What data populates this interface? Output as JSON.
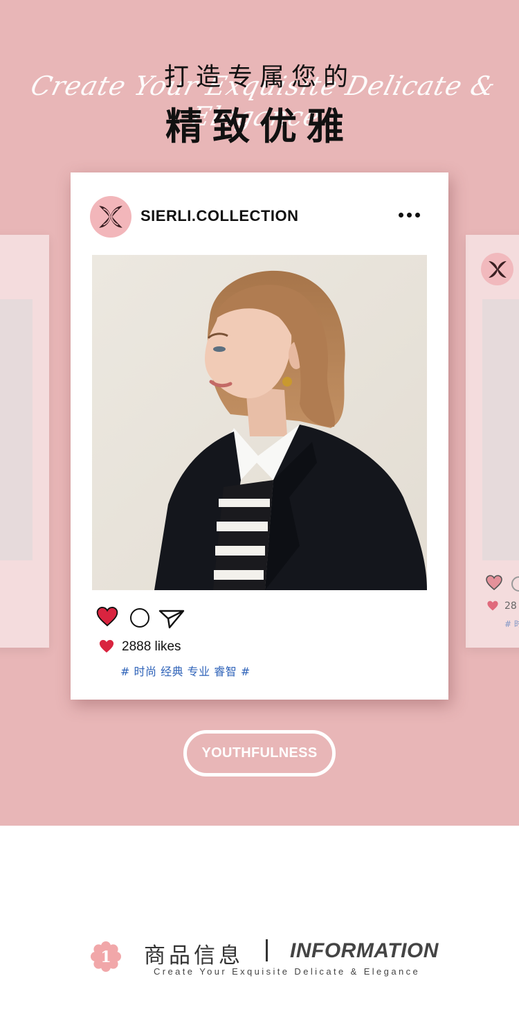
{
  "hero": {
    "headline_line1": "打造专属您的",
    "headline_script": "Create Your Exquisite Delicate & Elegance",
    "headline_line2": "精致优雅"
  },
  "post": {
    "account_name": "SIERLI.COLLECTION",
    "likes_text": "2888 likes",
    "hashtags": "# 时尚 经典 专业 睿智 #"
  },
  "side_card_right": {
    "likes_partial": "28",
    "tags_partial": "# 时"
  },
  "cta": {
    "label": "YOUTHFULNESS"
  },
  "section": {
    "number": "1",
    "title_cn": "商品信息",
    "title_en": "INFORMATION",
    "subtitle": "Create Your Exquisite Delicate & Elegance"
  },
  "colors": {
    "background_pink": "#e8b6b7",
    "heart_red": "#d9243f",
    "hashtag_blue": "#2f63b9",
    "avatar_pink": "#f2b6ba"
  },
  "icons": [
    "more-icon",
    "heart-icon",
    "comment-icon",
    "share-icon",
    "brand-logo-icon",
    "flower-number-icon"
  ]
}
